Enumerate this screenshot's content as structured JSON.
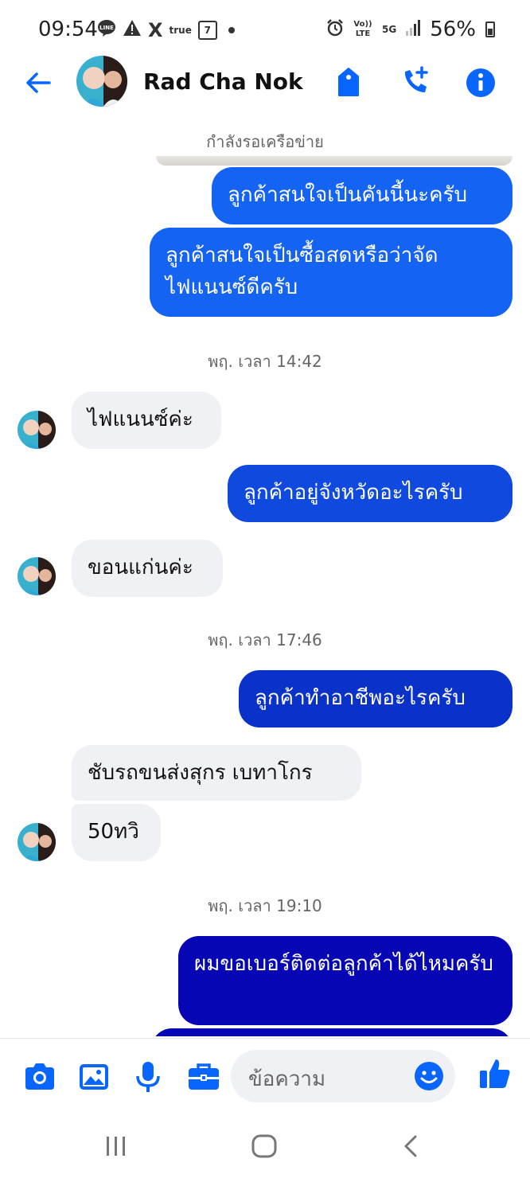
{
  "status_bar": {
    "time": "09:54",
    "left_icons": [
      "line-icon",
      "warning-icon",
      "x-icon",
      "truemove-icon",
      "seven-eleven-icon"
    ],
    "line_label": "LINE",
    "x_label": "X",
    "true_label": "true",
    "seven_label": "7",
    "volte_label": "Vo)) LTE",
    "net_label": "5G",
    "battery": "56%"
  },
  "header": {
    "contact_name": "Rad Cha Nok",
    "accent": "#0866ff"
  },
  "chat": {
    "network_status": "กำลังรอเครือข่าย",
    "messages": [
      {
        "dir": "out",
        "text": "ลูกค้าสนใจเป็นคันนี้นะครับ",
        "color": "#1463f3"
      },
      {
        "dir": "out",
        "text": "ลูกค้าสนใจเป็นซื้อสดหรือว่าจัดไฟแนนซ์ดีครับ",
        "color": "#1463f3"
      },
      {
        "dir": "sep",
        "text": "พฤ. เวลา 14:42"
      },
      {
        "dir": "in",
        "text": "ไฟแนนซ์ค่ะ"
      },
      {
        "dir": "out",
        "text": "ลูกค้าอยู่จังหวัดอะไรครับ",
        "color": "#0f49de"
      },
      {
        "dir": "in",
        "text": "ขอนแก่นค่ะ"
      },
      {
        "dir": "sep",
        "text": "พฤ. เวลา 17:46"
      },
      {
        "dir": "out",
        "text": "ลูกค้าทำอาชีพอะไรครับ",
        "color": "#0a32c8"
      },
      {
        "dir": "in",
        "text": "ชับรถขนส่งสุกร เบทาโกร"
      },
      {
        "dir": "in",
        "text": "50ทวิ"
      },
      {
        "dir": "sep",
        "text": "พฤ. เวลา 19:10"
      },
      {
        "dir": "out",
        "text": "ผมขอเบอร์ติดต่อลูกค้าได้ไหมครับ",
        "color": "#0606b4"
      }
    ]
  },
  "composer": {
    "placeholder": "ข้อความ",
    "buttons": [
      "camera-icon",
      "image-icon",
      "microphone-icon",
      "briefcase-icon",
      "emoji-icon",
      "thumbs-up-icon"
    ]
  },
  "nav": [
    "recents-icon",
    "home-icon",
    "back-icon"
  ]
}
